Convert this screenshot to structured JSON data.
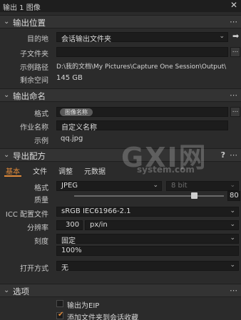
{
  "titlebar": {
    "title": "输出 1 图像",
    "close_icon": "close-icon"
  },
  "output_location": {
    "title": "输出位置",
    "destination_label": "目的地",
    "destination_value": "会话输出文件夹",
    "subfolder_label": "子文件夹",
    "subfolder_value": "",
    "sample_path_label": "示例路径",
    "sample_path_value": "D:\\我的文档\\My Pictures\\Capture One Session\\Output\\",
    "space_label": "剩余空间",
    "space_value": "145 GB"
  },
  "output_naming": {
    "title": "输出命名",
    "format_label": "格式",
    "format_token": "图像名称",
    "job_name_label": "作业名称",
    "job_name_value": "自定义名称",
    "example_label": "示例",
    "example_value": "qq.jpg"
  },
  "export_recipe": {
    "title": "导出配方",
    "help_icon": "?",
    "tabs": [
      "基本",
      "文件",
      "调整",
      "元数据"
    ],
    "active_tab": 0,
    "format_label": "格式",
    "format_value": "JPEG",
    "bitdepth_value": "8 bit",
    "quality_label": "质量",
    "quality_value": "80",
    "quality_fraction": 0.8,
    "icc_label": "ICC 配置文件",
    "icc_value": "sRGB IEC61966-2.1",
    "resolution_label": "分辨率",
    "resolution_value": "300",
    "resolution_unit": "px/in",
    "scale_label": "刻度",
    "scale_value": "固定",
    "scale_percent": "100%",
    "open_with_label": "打开方式",
    "open_with_value": "无"
  },
  "options": {
    "title": "选项",
    "eip_label": "输出为EIP",
    "eip_checked": false,
    "add_to_album_label": "添加文件夹到会话收藏",
    "add_to_album_checked": true
  },
  "watermark": {
    "main": "GXI网",
    "sub": "system.com"
  },
  "colors": {
    "accent": "#e08a3a",
    "background": "#2b2b2b",
    "header": "#333333"
  }
}
